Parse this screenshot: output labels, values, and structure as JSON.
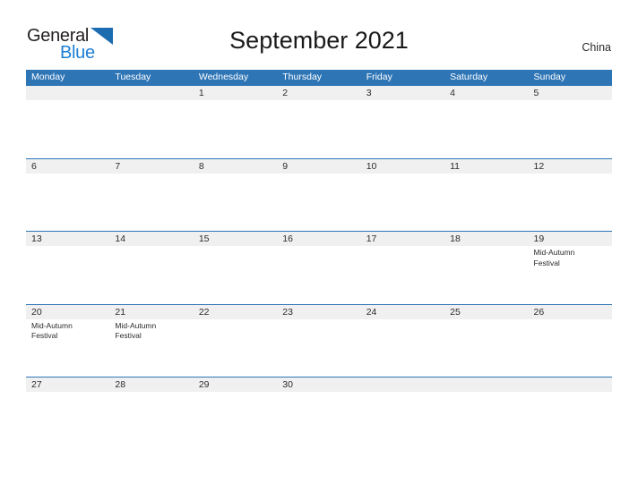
{
  "brand": {
    "name_part1": "General",
    "name_part2": "Blue",
    "flag_icon": "blue-triangle-flag-icon"
  },
  "header": {
    "title": "September 2021",
    "country": "China"
  },
  "colors": {
    "header_blue": "#2e75b6",
    "band_gray": "#f0f0f0",
    "logo_blue": "#1c7fd4",
    "logo_dark": "#231f20",
    "text": "#2b2b2b"
  },
  "calendar": {
    "weekdays": [
      "Monday",
      "Tuesday",
      "Wednesday",
      "Thursday",
      "Friday",
      "Saturday",
      "Sunday"
    ],
    "weeks": [
      [
        {
          "day": "",
          "event": ""
        },
        {
          "day": "",
          "event": ""
        },
        {
          "day": "1",
          "event": ""
        },
        {
          "day": "2",
          "event": ""
        },
        {
          "day": "3",
          "event": ""
        },
        {
          "day": "4",
          "event": ""
        },
        {
          "day": "5",
          "event": ""
        }
      ],
      [
        {
          "day": "6",
          "event": ""
        },
        {
          "day": "7",
          "event": ""
        },
        {
          "day": "8",
          "event": ""
        },
        {
          "day": "9",
          "event": ""
        },
        {
          "day": "10",
          "event": ""
        },
        {
          "day": "11",
          "event": ""
        },
        {
          "day": "12",
          "event": ""
        }
      ],
      [
        {
          "day": "13",
          "event": ""
        },
        {
          "day": "14",
          "event": ""
        },
        {
          "day": "15",
          "event": ""
        },
        {
          "day": "16",
          "event": ""
        },
        {
          "day": "17",
          "event": ""
        },
        {
          "day": "18",
          "event": ""
        },
        {
          "day": "19",
          "event": "Mid-Autumn Festival"
        }
      ],
      [
        {
          "day": "20",
          "event": "Mid-Autumn Festival"
        },
        {
          "day": "21",
          "event": "Mid-Autumn Festival"
        },
        {
          "day": "22",
          "event": ""
        },
        {
          "day": "23",
          "event": ""
        },
        {
          "day": "24",
          "event": ""
        },
        {
          "day": "25",
          "event": ""
        },
        {
          "day": "26",
          "event": ""
        }
      ],
      [
        {
          "day": "27",
          "event": ""
        },
        {
          "day": "28",
          "event": ""
        },
        {
          "day": "29",
          "event": ""
        },
        {
          "day": "30",
          "event": ""
        },
        {
          "day": "",
          "event": ""
        },
        {
          "day": "",
          "event": ""
        },
        {
          "day": "",
          "event": ""
        }
      ]
    ]
  }
}
